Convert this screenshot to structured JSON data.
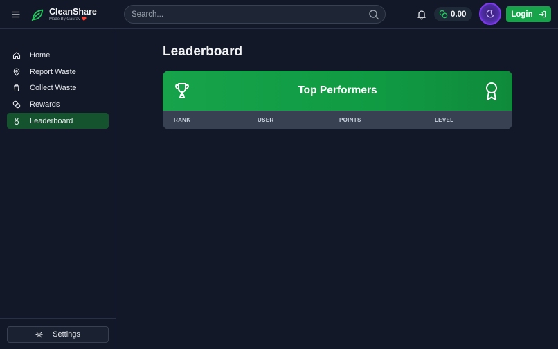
{
  "header": {
    "brand_name": "CleanShare",
    "brand_sub": "Made By Gaurav ❤️",
    "search_placeholder": "Search...",
    "balance": "0.00",
    "login_label": "Login"
  },
  "sidebar": {
    "items": [
      {
        "label": "Home",
        "icon": "home-icon",
        "active": false
      },
      {
        "label": "Report Waste",
        "icon": "map-pin-icon",
        "active": false
      },
      {
        "label": "Collect Waste",
        "icon": "trash-icon",
        "active": false
      },
      {
        "label": "Rewards",
        "icon": "coins-icon",
        "active": false
      },
      {
        "label": "Leaderboard",
        "icon": "medal-icon",
        "active": true
      }
    ],
    "settings_label": "Settings"
  },
  "main": {
    "title": "Leaderboard",
    "card_title": "Top Performers",
    "columns": [
      "RANK",
      "USER",
      "POINTS",
      "LEVEL"
    ]
  },
  "colors": {
    "accent": "#16a34a",
    "background": "#121827",
    "active_nav": "#15532f",
    "avatar_ring": "#7c3aed"
  }
}
